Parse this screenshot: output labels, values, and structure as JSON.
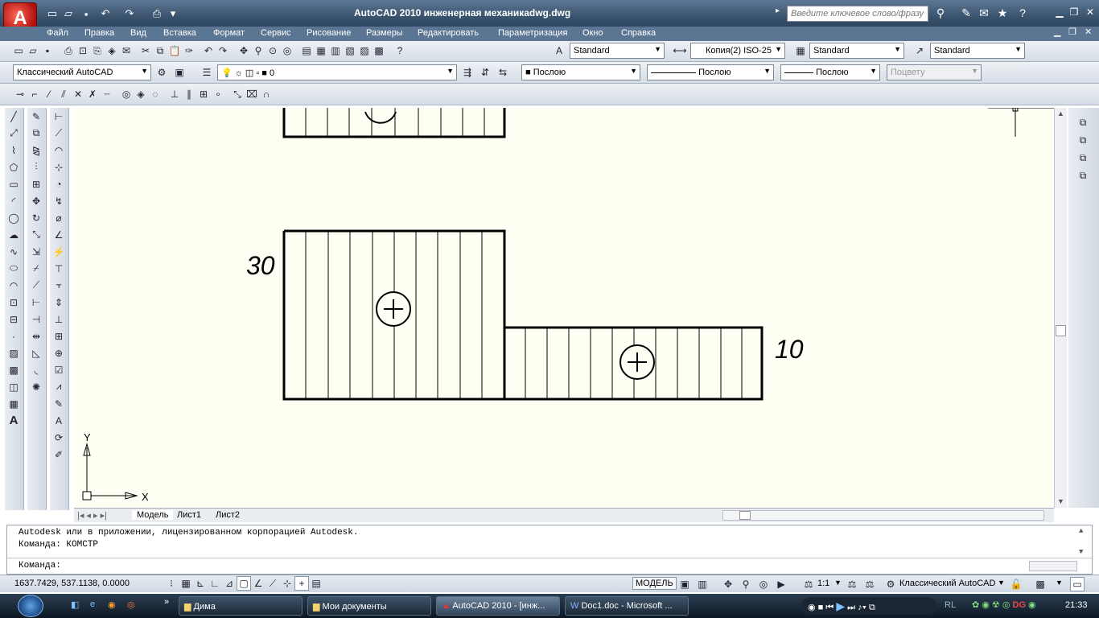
{
  "window": {
    "title": "AutoCAD 2010    инженерная механикadwg.dwg",
    "search_placeholder": "Введите ключевое слово/фразу",
    "app_button": "A"
  },
  "menu": [
    "Файл",
    "Правка",
    "Вид",
    "Вставка",
    "Формат",
    "Сервис",
    "Рисование",
    "Размеры",
    "Редактировать",
    "Параметризация",
    "Окно",
    "Справка"
  ],
  "styles_toolbar": {
    "text_style": "Standard",
    "dim_style": "Копия(2) ISO-25",
    "table_style": "Standard",
    "multileader_style": "Standard"
  },
  "layers_toolbar": {
    "workspace": "Классический AutoCAD",
    "layer": "0",
    "color": "Послою",
    "linetype": "Послою",
    "lineweight": "Послою",
    "plotstyle": "Поцвету"
  },
  "drawing": {
    "label_30": "30",
    "label_10": "10",
    "ucs_x": "X",
    "ucs_y": "Y"
  },
  "layout_tabs": [
    "Модель",
    "Лист1",
    "Лист2"
  ],
  "command_line": {
    "line1": "Autodesk или в приложении, лицензированном корпорацией Autodesk.",
    "line2": "Команда: КОМСТР",
    "prompt": "Команда:"
  },
  "status_bar": {
    "coordinates": "1637.7429, 537.1138, 0.0000",
    "model_label": "МОДЕЛЬ",
    "scale": "1:1",
    "workspace": "Классический AutoCAD"
  },
  "taskbar": {
    "tasks": [
      "Дима",
      "Мои документы",
      "AutoCAD 2010 - [инж...",
      "Doc1.doc - Microsoft ..."
    ],
    "language": "RL",
    "clock": "21:33"
  },
  "colors": {
    "title_bar": "#3c556f",
    "canvas_bg": "#fffff3",
    "accent_red": "#c8140f"
  }
}
